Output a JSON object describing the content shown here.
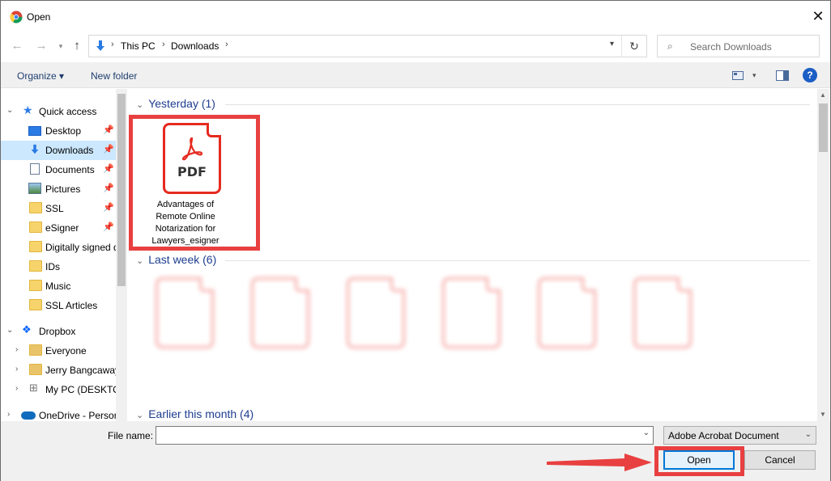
{
  "window": {
    "title": "Open",
    "close_glyph": "✕"
  },
  "address": {
    "crumbs": [
      "This PC",
      "Downloads"
    ],
    "search_placeholder": "Search Downloads"
  },
  "toolbar": {
    "organize": "Organize ▾",
    "new_folder": "New folder",
    "help": "?"
  },
  "sidebar": {
    "items": [
      {
        "label": "Quick access",
        "icon": "star-icon"
      },
      {
        "label": "Desktop",
        "icon": "desktop-icon"
      },
      {
        "label": "Downloads",
        "icon": "download-arrow-icon"
      },
      {
        "label": "Documents",
        "icon": "documents-icon"
      },
      {
        "label": "Pictures",
        "icon": "pictures-icon"
      },
      {
        "label": "SSL",
        "icon": "folder-icon"
      },
      {
        "label": "eSigner",
        "icon": "folder-icon"
      },
      {
        "label": "Digitally signed d",
        "icon": "folder-icon"
      },
      {
        "label": "IDs",
        "icon": "folder-icon"
      },
      {
        "label": "Music",
        "icon": "folder-icon"
      },
      {
        "label": "SSL Articles",
        "icon": "folder-icon"
      },
      {
        "label": "Dropbox",
        "icon": "dropbox-icon"
      },
      {
        "label": "Everyone",
        "icon": "shared-folder-icon"
      },
      {
        "label": "Jerry Bangcaway",
        "icon": "shared-folder-icon"
      },
      {
        "label": "My PC (DESKTOP",
        "icon": "pc-icon"
      },
      {
        "label": "OneDrive - Persor",
        "icon": "onedrive-icon"
      }
    ]
  },
  "groups": {
    "yesterday": "Yesterday (1)",
    "last_week": "Last week (6)",
    "earlier": "Earlier this month (4)"
  },
  "files": {
    "highlighted_name": "Advantages of Remote Online Notarization for Lawyers_esigner",
    "pdf_label": "PDF"
  },
  "footer": {
    "file_name_label": "File name:",
    "file_name_value": "",
    "file_type": "Adobe Acrobat Document",
    "open_label": "Open",
    "cancel_label": "Cancel"
  },
  "colors": {
    "highlight": "#e84040",
    "accent": "#0078d7",
    "pdf_red": "#e52a1f"
  }
}
